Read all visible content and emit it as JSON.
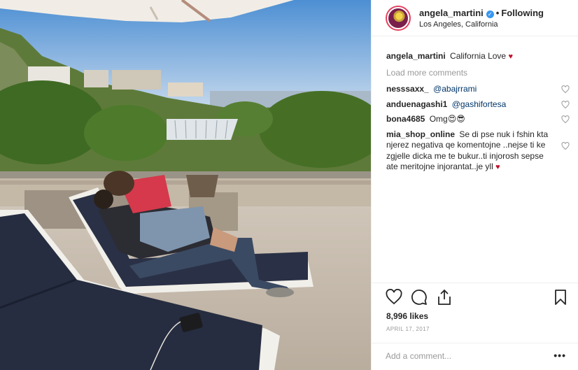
{
  "header": {
    "username": "angela_martini",
    "separator": "•",
    "follow_label": "Following",
    "location": "Los Angeles, California"
  },
  "caption": {
    "username": "angela_martini",
    "text": "California Love",
    "emoji": "♥"
  },
  "load_more_label": "Load more comments",
  "comments": [
    {
      "username": "nesssaxx_",
      "text": "@abajrrami"
    },
    {
      "username": "anduenagashi1",
      "text": "@gashifortesa"
    },
    {
      "username": "bona4685",
      "text": "Omg😍😎"
    },
    {
      "username": "mia_shop_online",
      "text": "Se di pse nuk i fshin kta njerez negativa qe komentojne ..nejse ti ke zgjelle dicka me te bukur..ti injorosh sepse ate meritojne injorantat..je yll",
      "emoji": "♥"
    }
  ],
  "likes_text": "8,996 likes",
  "date_text": "APRIL 17, 2017",
  "add_comment_placeholder": "Add a comment...",
  "more_label": "•••",
  "icons": {
    "like": "heart-icon",
    "comment": "comment-icon",
    "share": "share-icon",
    "save": "bookmark-icon",
    "verified": "verified-badge-icon"
  },
  "colors": {
    "accent_blue": "#3897f0",
    "heart_red": "#c0142b",
    "muted_text": "#999999",
    "mention": "#003569"
  }
}
